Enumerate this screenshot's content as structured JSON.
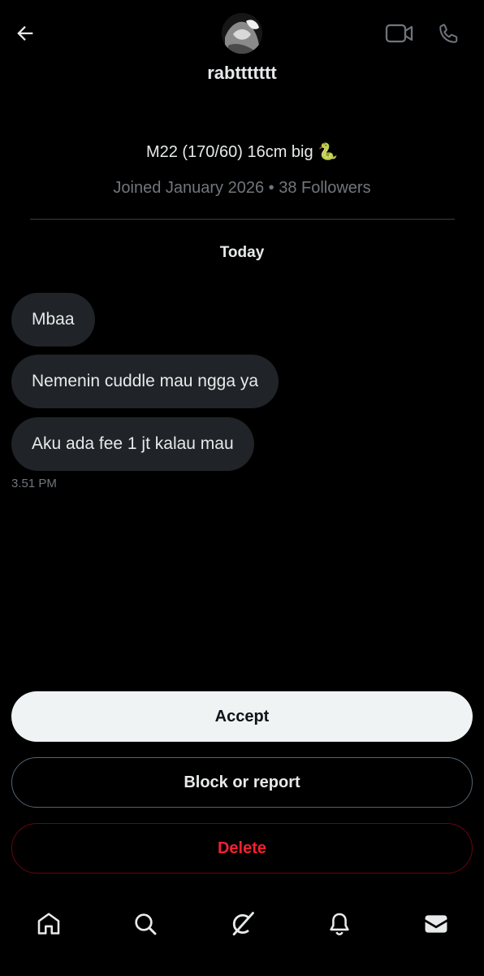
{
  "header": {
    "username": "rabttttttt",
    "back_icon": "arrow-left-icon",
    "video_icon": "video-camera-icon",
    "call_icon": "phone-icon"
  },
  "profile": {
    "bio": "M22 (170/60) 16cm big 🐍",
    "meta": "Joined January 2026 • 38 Followers"
  },
  "conversation": {
    "day_label": "Today",
    "messages": [
      {
        "text": "Mbaa"
      },
      {
        "text": "Nemenin cuddle mau ngga ya"
      },
      {
        "text": "Aku ada fee 1 jt kalau mau"
      }
    ],
    "timestamp": "3.51 PM"
  },
  "actions": {
    "accept_label": "Accept",
    "block_label": "Block or report",
    "delete_label": "Delete"
  },
  "bottom_nav": {
    "items": [
      {
        "icon": "home-icon"
      },
      {
        "icon": "search-icon"
      },
      {
        "icon": "grok-icon"
      },
      {
        "icon": "bell-icon"
      },
      {
        "icon": "mail-icon",
        "active": true
      }
    ]
  },
  "colors": {
    "background": "#000000",
    "bubble": "#202327",
    "secondary_text": "#71767b",
    "delete_red": "#f4212e",
    "accept_bg": "#eff3f4"
  }
}
